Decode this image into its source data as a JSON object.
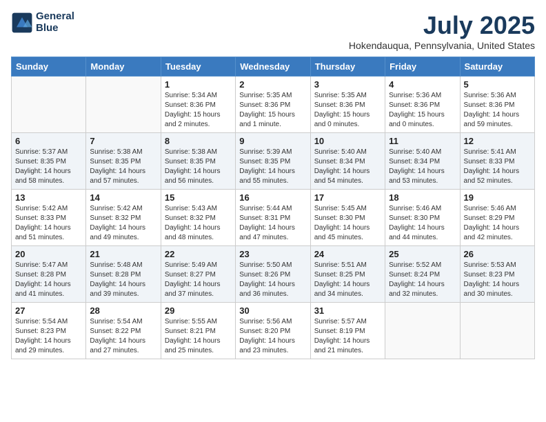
{
  "header": {
    "logo_line1": "General",
    "logo_line2": "Blue",
    "month": "July 2025",
    "location": "Hokendauqua, Pennsylvania, United States"
  },
  "weekdays": [
    "Sunday",
    "Monday",
    "Tuesday",
    "Wednesday",
    "Thursday",
    "Friday",
    "Saturday"
  ],
  "weeks": [
    [
      {
        "day": "",
        "text": ""
      },
      {
        "day": "",
        "text": ""
      },
      {
        "day": "1",
        "text": "Sunrise: 5:34 AM\nSunset: 8:36 PM\nDaylight: 15 hours\nand 2 minutes."
      },
      {
        "day": "2",
        "text": "Sunrise: 5:35 AM\nSunset: 8:36 PM\nDaylight: 15 hours\nand 1 minute."
      },
      {
        "day": "3",
        "text": "Sunrise: 5:35 AM\nSunset: 8:36 PM\nDaylight: 15 hours\nand 0 minutes."
      },
      {
        "day": "4",
        "text": "Sunrise: 5:36 AM\nSunset: 8:36 PM\nDaylight: 15 hours\nand 0 minutes."
      },
      {
        "day": "5",
        "text": "Sunrise: 5:36 AM\nSunset: 8:36 PM\nDaylight: 14 hours\nand 59 minutes."
      }
    ],
    [
      {
        "day": "6",
        "text": "Sunrise: 5:37 AM\nSunset: 8:35 PM\nDaylight: 14 hours\nand 58 minutes."
      },
      {
        "day": "7",
        "text": "Sunrise: 5:38 AM\nSunset: 8:35 PM\nDaylight: 14 hours\nand 57 minutes."
      },
      {
        "day": "8",
        "text": "Sunrise: 5:38 AM\nSunset: 8:35 PM\nDaylight: 14 hours\nand 56 minutes."
      },
      {
        "day": "9",
        "text": "Sunrise: 5:39 AM\nSunset: 8:35 PM\nDaylight: 14 hours\nand 55 minutes."
      },
      {
        "day": "10",
        "text": "Sunrise: 5:40 AM\nSunset: 8:34 PM\nDaylight: 14 hours\nand 54 minutes."
      },
      {
        "day": "11",
        "text": "Sunrise: 5:40 AM\nSunset: 8:34 PM\nDaylight: 14 hours\nand 53 minutes."
      },
      {
        "day": "12",
        "text": "Sunrise: 5:41 AM\nSunset: 8:33 PM\nDaylight: 14 hours\nand 52 minutes."
      }
    ],
    [
      {
        "day": "13",
        "text": "Sunrise: 5:42 AM\nSunset: 8:33 PM\nDaylight: 14 hours\nand 51 minutes."
      },
      {
        "day": "14",
        "text": "Sunrise: 5:42 AM\nSunset: 8:32 PM\nDaylight: 14 hours\nand 49 minutes."
      },
      {
        "day": "15",
        "text": "Sunrise: 5:43 AM\nSunset: 8:32 PM\nDaylight: 14 hours\nand 48 minutes."
      },
      {
        "day": "16",
        "text": "Sunrise: 5:44 AM\nSunset: 8:31 PM\nDaylight: 14 hours\nand 47 minutes."
      },
      {
        "day": "17",
        "text": "Sunrise: 5:45 AM\nSunset: 8:30 PM\nDaylight: 14 hours\nand 45 minutes."
      },
      {
        "day": "18",
        "text": "Sunrise: 5:46 AM\nSunset: 8:30 PM\nDaylight: 14 hours\nand 44 minutes."
      },
      {
        "day": "19",
        "text": "Sunrise: 5:46 AM\nSunset: 8:29 PM\nDaylight: 14 hours\nand 42 minutes."
      }
    ],
    [
      {
        "day": "20",
        "text": "Sunrise: 5:47 AM\nSunset: 8:28 PM\nDaylight: 14 hours\nand 41 minutes."
      },
      {
        "day": "21",
        "text": "Sunrise: 5:48 AM\nSunset: 8:28 PM\nDaylight: 14 hours\nand 39 minutes."
      },
      {
        "day": "22",
        "text": "Sunrise: 5:49 AM\nSunset: 8:27 PM\nDaylight: 14 hours\nand 37 minutes."
      },
      {
        "day": "23",
        "text": "Sunrise: 5:50 AM\nSunset: 8:26 PM\nDaylight: 14 hours\nand 36 minutes."
      },
      {
        "day": "24",
        "text": "Sunrise: 5:51 AM\nSunset: 8:25 PM\nDaylight: 14 hours\nand 34 minutes."
      },
      {
        "day": "25",
        "text": "Sunrise: 5:52 AM\nSunset: 8:24 PM\nDaylight: 14 hours\nand 32 minutes."
      },
      {
        "day": "26",
        "text": "Sunrise: 5:53 AM\nSunset: 8:23 PM\nDaylight: 14 hours\nand 30 minutes."
      }
    ],
    [
      {
        "day": "27",
        "text": "Sunrise: 5:54 AM\nSunset: 8:23 PM\nDaylight: 14 hours\nand 29 minutes."
      },
      {
        "day": "28",
        "text": "Sunrise: 5:54 AM\nSunset: 8:22 PM\nDaylight: 14 hours\nand 27 minutes."
      },
      {
        "day": "29",
        "text": "Sunrise: 5:55 AM\nSunset: 8:21 PM\nDaylight: 14 hours\nand 25 minutes."
      },
      {
        "day": "30",
        "text": "Sunrise: 5:56 AM\nSunset: 8:20 PM\nDaylight: 14 hours\nand 23 minutes."
      },
      {
        "day": "31",
        "text": "Sunrise: 5:57 AM\nSunset: 8:19 PM\nDaylight: 14 hours\nand 21 minutes."
      },
      {
        "day": "",
        "text": ""
      },
      {
        "day": "",
        "text": ""
      }
    ]
  ]
}
